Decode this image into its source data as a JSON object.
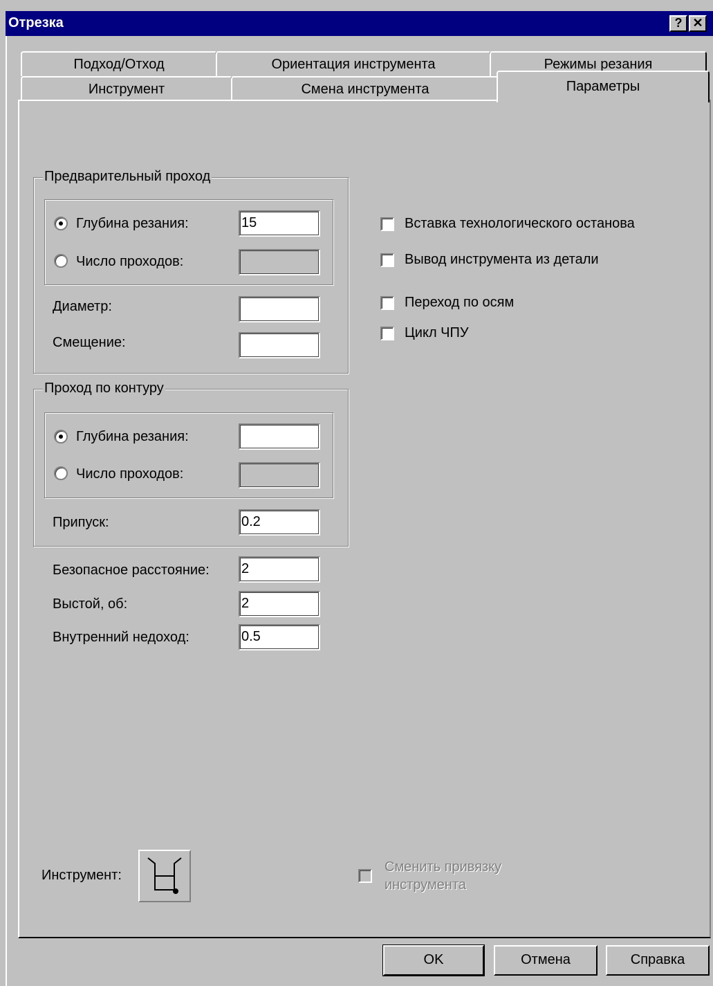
{
  "window": {
    "title": "Отрезка",
    "help_button": "?",
    "close_button": "✕"
  },
  "tabs": {
    "row1": [
      "Подход/Отход",
      "Ориентация инструмента",
      "Режимы резания"
    ],
    "row2": [
      "Инструмент",
      "Смена инструмента",
      "Параметры"
    ],
    "active": "Параметры"
  },
  "preliminary_pass": {
    "title": "Предварительный проход",
    "cut_depth_label": "Глубина резания:",
    "cut_depth_value": "15",
    "cut_depth_selected": true,
    "passes_label": "Число проходов:",
    "passes_value": "",
    "diameter_label": "Диаметр:",
    "diameter_value": "",
    "offset_label": "Смещение:",
    "offset_value": ""
  },
  "contour_pass": {
    "title": "Проход по контуру",
    "cut_depth_label": "Глубина резания:",
    "cut_depth_value": "",
    "cut_depth_selected": true,
    "passes_label": "Число проходов:",
    "passes_value": "",
    "allowance_label": "Припуск:",
    "allowance_value": "0.2"
  },
  "safe_distance": {
    "label": "Безопасное расстояние:",
    "value": "2"
  },
  "dwell": {
    "label": "Выстой, об:",
    "value": "2"
  },
  "inner_undercut": {
    "label": "Внутренний недоход:",
    "value": "0.5"
  },
  "options": {
    "insert_stop": {
      "label": "Вставка технологического останова",
      "checked": false
    },
    "tool_retract": {
      "label": "Вывод инструмента из детали",
      "checked": false
    },
    "axis_move": {
      "label": "Переход по осям",
      "checked": false
    },
    "cnc_cycle": {
      "label": "Цикл ЧПУ",
      "checked": false
    }
  },
  "tool": {
    "label": "Инструмент:",
    "icon": "cutoff-tool-icon",
    "change_binding_line1": "Сменить привязку",
    "change_binding_line2": "инструмента",
    "change_binding_enabled": false
  },
  "buttons": {
    "ok": "OK",
    "cancel": "Отмена",
    "help": "Справка"
  }
}
